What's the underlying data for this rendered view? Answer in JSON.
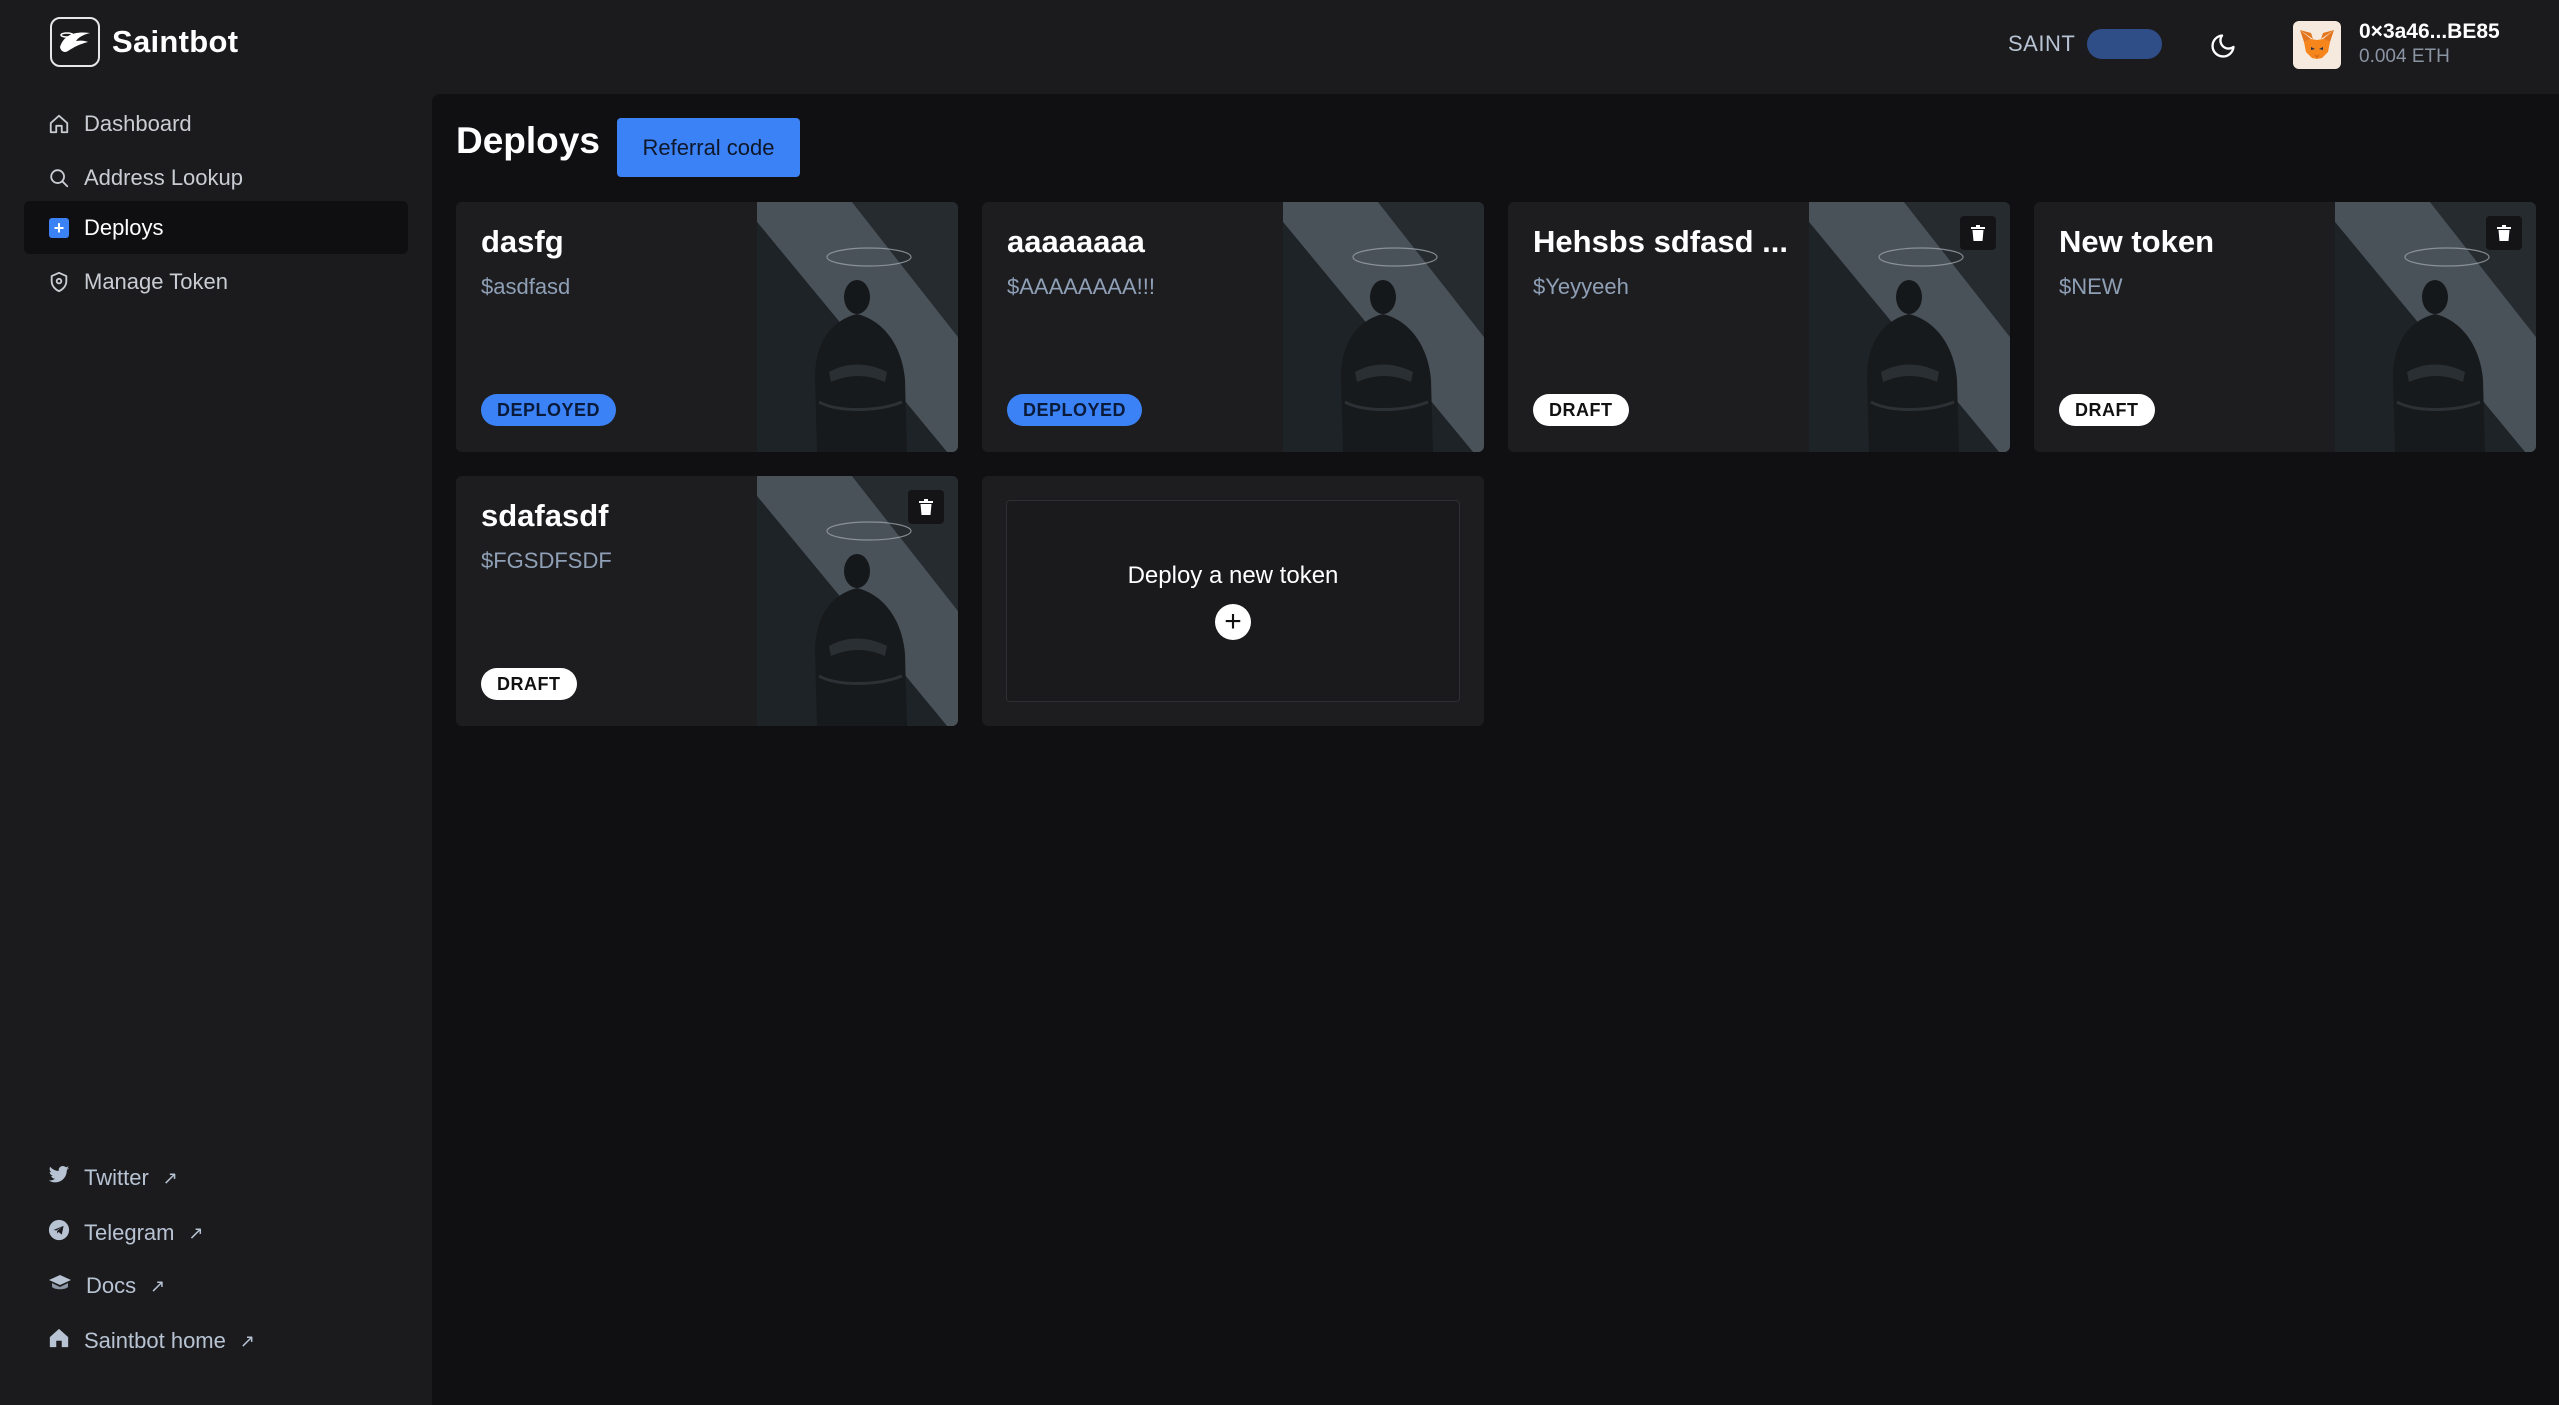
{
  "app": {
    "name": "Saintbot"
  },
  "topbar": {
    "token_label": "SAINT",
    "wallet": {
      "address": "0×3a46...BE85",
      "balance": "0.004 ETH"
    }
  },
  "sidebar": {
    "items": [
      {
        "label": "Dashboard",
        "icon": "home-icon"
      },
      {
        "label": "Address Lookup",
        "icon": "search-icon"
      },
      {
        "label": "Deploys",
        "icon": "plus-square-icon"
      },
      {
        "label": "Manage Token",
        "icon": "shield-icon"
      }
    ],
    "links": [
      {
        "label": "Twitter",
        "icon": "twitter-icon"
      },
      {
        "label": "Telegram",
        "icon": "telegram-icon"
      },
      {
        "label": "Docs",
        "icon": "docs-icon"
      },
      {
        "label": "Saintbot home",
        "icon": "home-filled-icon"
      }
    ],
    "ext_arrow": "↗"
  },
  "main": {
    "title": "Deploys",
    "referral_label": "Referral code",
    "cards": [
      {
        "name": "dasfg",
        "ticker": "$asdfasd",
        "status": "DEPLOYED"
      },
      {
        "name": "aaaaaaaa",
        "ticker": "$AAAAAAAA!!!",
        "status": "DEPLOYED"
      },
      {
        "name": "Hehsbs sdfasd ...",
        "ticker": "$Yeyyeeh",
        "status": "DRAFT"
      },
      {
        "name": "New token",
        "ticker": "$NEW",
        "status": "DRAFT"
      },
      {
        "name": "sdafasdf",
        "ticker": "$FGSDFSDF",
        "status": "DRAFT"
      }
    ],
    "new_token_label": "Deploy a new token",
    "plus": "+"
  }
}
